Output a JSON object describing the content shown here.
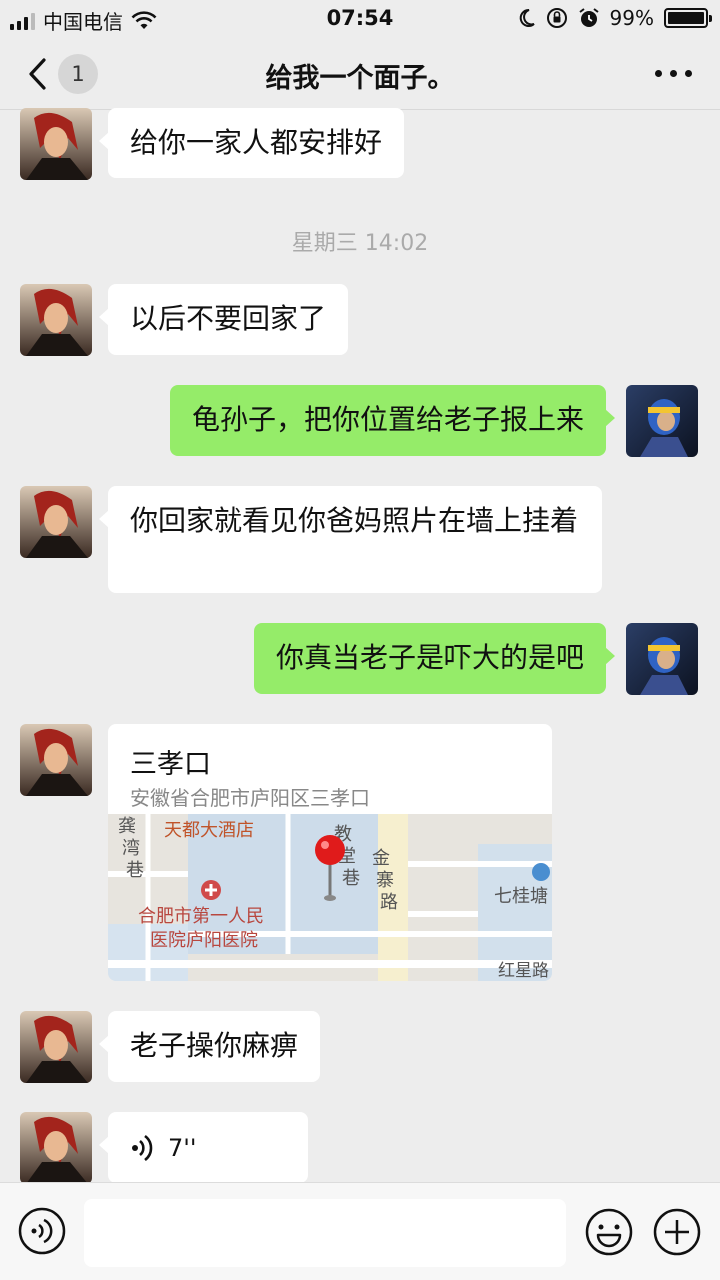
{
  "status_bar": {
    "carrier": "中国电信",
    "time": "07:54",
    "battery_text": "99%",
    "battery_level": 0.99
  },
  "nav": {
    "unread_count": "1",
    "title": "给我一个面子。"
  },
  "messages": [
    {
      "side": "left",
      "text": "给你一家人都安排好"
    },
    {
      "side": "time",
      "text": "星期三 14:02"
    },
    {
      "side": "left",
      "text": "以后不要回家了"
    },
    {
      "side": "right",
      "text": "龟孙子，把你位置给老子报上来"
    },
    {
      "side": "left",
      "text": "你回家就看见你爸妈照片在墙上挂着"
    },
    {
      "side": "right",
      "text": "你真当老子是吓大的是吧"
    },
    {
      "side": "left",
      "type": "location",
      "name": "三孝口",
      "address": "安徽省合肥市庐阳区三孝口"
    },
    {
      "side": "left",
      "text": "老子操你麻痹"
    },
    {
      "side": "left",
      "type": "voice",
      "duration": "7''"
    }
  ],
  "location": {
    "name": "三孝口",
    "address": "安徽省合肥市庐阳区三孝口",
    "map_labels": {
      "hotel": "天都大酒店",
      "lane1_a": "龚",
      "lane1_b": "湾",
      "lane1_c": "巷",
      "lane2_a": "教",
      "lane2_b": "堂",
      "lane2_c": "巷",
      "road_a": "金",
      "road_b": "寨",
      "road_c": "路",
      "hospital_l1": "合肥市第一人民",
      "hospital_l2": "医院庐阳医院",
      "pond": "七桂塘",
      "hongxing": "红星路"
    }
  },
  "colors": {
    "background": "#ededed",
    "bubble_self": "#95ec69",
    "bubble_other": "#ffffff",
    "timestamp": "#aaaaaa"
  }
}
